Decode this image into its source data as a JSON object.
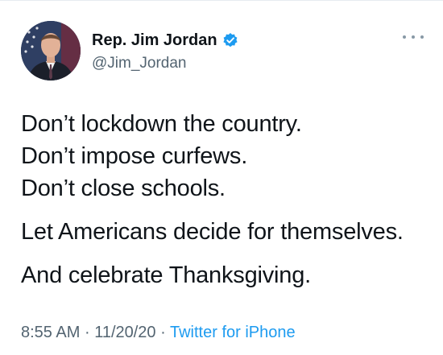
{
  "tweet": {
    "author": {
      "display_name": "Rep. Jim Jordan",
      "handle": "@Jim_Jordan",
      "verified": true
    },
    "text_lines": [
      "Don’t lockdown the country.",
      "Don’t impose curfews.",
      "Don’t close schools.",
      "Let Americans decide for themselves.",
      "And celebrate Thanksgiving."
    ],
    "time": "8:55 AM",
    "separator": "·",
    "date": "11/20/20",
    "source": "Twitter for iPhone"
  },
  "icons": {
    "verified": "verified-badge-icon",
    "more": "more-options-icon"
  },
  "colors": {
    "accent": "#1d9bf0",
    "text": "#0f1419",
    "muted": "#536471"
  }
}
